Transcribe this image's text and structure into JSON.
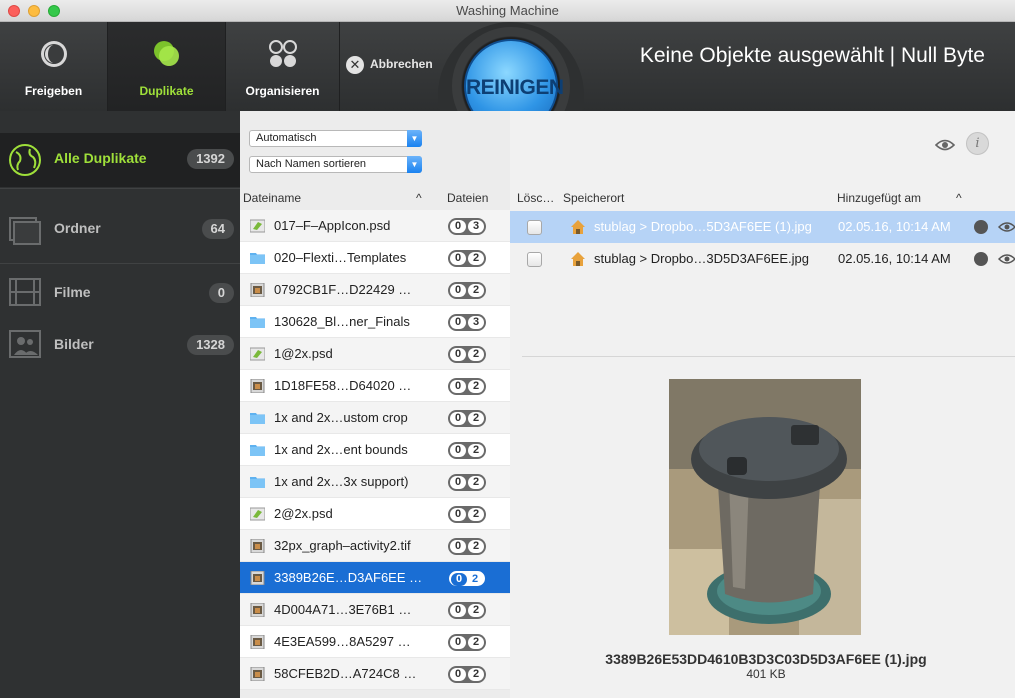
{
  "window": {
    "title": "Washing Machine"
  },
  "toolbar": {
    "share_label": "Freigeben",
    "duplicates_label": "Duplikate",
    "organize_label": "Organisieren",
    "cancel_label": "Abbrechen",
    "clean_label": "REINIGEN",
    "status": "Keine Objekte ausgewählt | Null Byte",
    "accent": "#9fe03a"
  },
  "sidebar": {
    "items": [
      {
        "label": "Alle Duplikate",
        "count": "1392"
      },
      {
        "label": "Ordner",
        "count": "64"
      },
      {
        "label": "Filme",
        "count": "0"
      },
      {
        "label": "Bilder",
        "count": "1328"
      }
    ]
  },
  "filelist": {
    "filter_value": "Automatisch",
    "sort_value": "Nach Namen sortieren",
    "col_name": "Dateiname",
    "col_files": "Dateien",
    "rows": [
      {
        "name": "017–F–AppIcon.psd",
        "icon": "psd-icon",
        "a": "0",
        "b": "3"
      },
      {
        "name": "020–Flexti…Templates",
        "icon": "folder-icon",
        "a": "0",
        "b": "2"
      },
      {
        "name": "0792CB1F…D22429 …",
        "icon": "image-icon",
        "a": "0",
        "b": "2"
      },
      {
        "name": "130628_Bl…ner_Finals",
        "icon": "folder-icon",
        "a": "0",
        "b": "3"
      },
      {
        "name": "1@2x.psd",
        "icon": "psd-icon",
        "a": "0",
        "b": "2"
      },
      {
        "name": "1D18FE58…D64020 …",
        "icon": "image-icon",
        "a": "0",
        "b": "2"
      },
      {
        "name": "1x and 2x…ustom crop",
        "icon": "folder-icon",
        "a": "0",
        "b": "2"
      },
      {
        "name": "1x and 2x…ent bounds",
        "icon": "folder-icon",
        "a": "0",
        "b": "2"
      },
      {
        "name": "1x and 2x…3x support)",
        "icon": "folder-icon",
        "a": "0",
        "b": "2"
      },
      {
        "name": "2@2x.psd",
        "icon": "psd-icon",
        "a": "0",
        "b": "2"
      },
      {
        "name": "32px_graph–activity2.tif",
        "icon": "image-icon",
        "a": "0",
        "b": "2"
      },
      {
        "name": "3389B26E…D3AF6EE …",
        "icon": "image-icon",
        "a": "0",
        "b": "2",
        "selected": true
      },
      {
        "name": "4D004A71…3E76B1 …",
        "icon": "image-icon",
        "a": "0",
        "b": "2"
      },
      {
        "name": "4E3EA599…8A5297 …",
        "icon": "image-icon",
        "a": "0",
        "b": "2"
      },
      {
        "name": "58CFEB2D…A724C8 …",
        "icon": "image-icon",
        "a": "0",
        "b": "2"
      }
    ]
  },
  "detail": {
    "col_delete": "Lösc…",
    "col_location": "Speicherort",
    "col_added": "Hinzugefügt am",
    "rows": [
      {
        "path": "stublag > Dropbo…5D3AF6EE (1).jpg",
        "date": "02.05.16, 10:14 AM",
        "selected": true
      },
      {
        "path": "stublag > Dropbo…3D5D3AF6EE.jpg",
        "date": "02.05.16, 10:14 AM"
      }
    ],
    "preview_name": "3389B26E53DD4610B3D3C03D5D3AF6EE (1).jpg",
    "preview_size": "401 KB"
  }
}
